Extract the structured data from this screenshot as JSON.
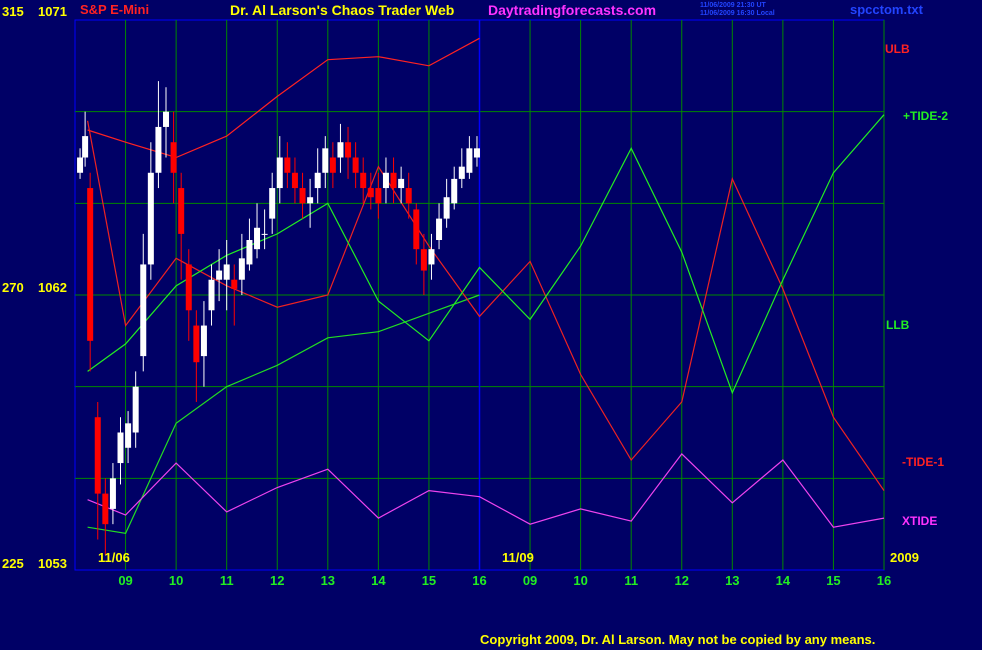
{
  "header": {
    "instrument": "S&P E-Mini",
    "title": "Dr. Al Larson's Chaos Trader Web",
    "site": "Daytradingforecasts.com",
    "timestamp_ut": "11/06/2009 21:30 UT",
    "timestamp_local": "11/06/2009 16:30 Local",
    "file": "spcctom.txt"
  },
  "footer": {
    "copyright": "Copyright 2009, Dr. Al Larson. May not be copied by any means."
  },
  "colors": {
    "background": "#000066",
    "grid": "#008800",
    "frame": "#0000ff",
    "price_up": "#ffffff",
    "price_down": "#ff0000",
    "ulb_line": "#ff2222",
    "llb_line": "#22dd22",
    "tide1_line": "#ee2222",
    "tide2_line": "#22ee22",
    "xtide_line": "#ee44ee",
    "label_yellow": "#ffff00",
    "label_green": "#22ee22",
    "label_red": "#ff2222",
    "label_magenta": "#ff33ff"
  },
  "chart_data": {
    "type": "line",
    "title": "S&P E-Mini",
    "y_axis_left": {
      "labels": [
        {
          "field": "315",
          "price": "1071"
        },
        {
          "field": "270",
          "price": "1062"
        },
        {
          "field": "225",
          "price": "1053"
        }
      ],
      "ylim": [
        1053,
        1071
      ]
    },
    "x_axis": {
      "day1_label": "11/06",
      "day2_label": "11/09",
      "year_label": "2009",
      "day1_hours": [
        "09",
        "10",
        "11",
        "12",
        "13",
        "14",
        "15",
        "16"
      ],
      "day2_hours": [
        "09",
        "10",
        "11",
        "12",
        "13",
        "14",
        "15",
        "16"
      ]
    },
    "series_labels": {
      "ulb": "ULB",
      "tide2": "+TIDE-2",
      "llb": "LLB",
      "tide1": "-TIDE-1",
      "xtide": "XTIDE"
    },
    "series": [
      {
        "name": "ULB",
        "x": [
          8.25,
          9,
          10,
          11,
          12,
          13,
          14,
          15,
          16
        ],
        "y": [
          1067.4,
          1067.0,
          1066.5,
          1067.2,
          1068.5,
          1069.7,
          1069.8,
          1069.5,
          1070.4
        ]
      },
      {
        "name": "LLB",
        "x": [
          8.25,
          9,
          10,
          11,
          12,
          13,
          14,
          15,
          16
        ],
        "y": [
          1054.4,
          1054.2,
          1057.8,
          1059.0,
          1059.7,
          1060.6,
          1060.8,
          1061.4,
          1062.0
        ]
      },
      {
        "name": "-TIDE-1",
        "x": [
          8.25,
          9,
          10,
          11,
          12,
          13,
          14,
          15,
          16,
          17,
          18,
          19,
          20,
          21,
          22,
          23,
          24
        ],
        "y": [
          1067.7,
          1061.0,
          1063.2,
          1062.3,
          1061.6,
          1062.0,
          1066.2,
          1063.6,
          1061.3,
          1063.1,
          1059.4,
          1056.6,
          1058.5,
          1065.8,
          1062.2,
          1058.0,
          1055.6
        ]
      },
      {
        "name": "+TIDE-2",
        "x": [
          8.25,
          9,
          10,
          11,
          12,
          13,
          14,
          15,
          16,
          17,
          18,
          19,
          20,
          21,
          22,
          23,
          24
        ],
        "y": [
          1059.5,
          1060.4,
          1062.3,
          1063.3,
          1064.0,
          1065.0,
          1061.8,
          1060.5,
          1062.9,
          1061.2,
          1063.6,
          1066.8,
          1063.4,
          1058.8,
          1062.5,
          1066.0,
          1067.9
        ]
      },
      {
        "name": "XTIDE",
        "x": [
          8.25,
          9,
          10,
          11,
          12,
          13,
          14,
          15,
          16,
          17,
          18,
          19,
          20,
          21,
          22,
          23,
          24
        ],
        "y": [
          1055.3,
          1054.8,
          1056.5,
          1054.9,
          1055.7,
          1056.3,
          1054.7,
          1055.6,
          1055.4,
          1054.5,
          1055.0,
          1054.6,
          1056.8,
          1055.2,
          1056.6,
          1054.4,
          1054.7
        ]
      }
    ],
    "price_bars": [
      {
        "x": 8.1,
        "o": 1066.0,
        "c": 1066.5,
        "h": 1066.8,
        "l": 1065.8
      },
      {
        "x": 8.2,
        "o": 1066.5,
        "c": 1067.2,
        "h": 1068.0,
        "l": 1066.2
      },
      {
        "x": 8.3,
        "o": 1065.5,
        "c": 1060.5,
        "h": 1066.0,
        "l": 1059.5
      },
      {
        "x": 8.45,
        "o": 1058.0,
        "c": 1055.5,
        "h": 1058.5,
        "l": 1054.0
      },
      {
        "x": 8.6,
        "o": 1055.5,
        "c": 1054.5,
        "h": 1056.0,
        "l": 1053.5
      },
      {
        "x": 8.75,
        "o": 1055.0,
        "c": 1056.0,
        "h": 1056.5,
        "l": 1054.5
      },
      {
        "x": 8.9,
        "o": 1056.5,
        "c": 1057.5,
        "h": 1058.0,
        "l": 1055.8
      },
      {
        "x": 9.05,
        "o": 1057.0,
        "c": 1057.8,
        "h": 1058.2,
        "l": 1056.5
      },
      {
        "x": 9.2,
        "o": 1057.5,
        "c": 1059.0,
        "h": 1059.5,
        "l": 1057.0
      },
      {
        "x": 9.35,
        "o": 1060.0,
        "c": 1063.0,
        "h": 1064.0,
        "l": 1059.5
      },
      {
        "x": 9.5,
        "o": 1063.0,
        "c": 1066.0,
        "h": 1067.0,
        "l": 1062.5
      },
      {
        "x": 9.65,
        "o": 1066.0,
        "c": 1067.5,
        "h": 1069.0,
        "l": 1065.5
      },
      {
        "x": 9.8,
        "o": 1067.5,
        "c": 1068.0,
        "h": 1068.8,
        "l": 1066.5
      },
      {
        "x": 9.95,
        "o": 1067.0,
        "c": 1066.0,
        "h": 1068.0,
        "l": 1065.0
      },
      {
        "x": 10.1,
        "o": 1065.5,
        "c": 1064.0,
        "h": 1066.0,
        "l": 1062.5
      },
      {
        "x": 10.25,
        "o": 1063.0,
        "c": 1061.5,
        "h": 1063.5,
        "l": 1060.5
      },
      {
        "x": 10.4,
        "o": 1061.0,
        "c": 1059.8,
        "h": 1061.5,
        "l": 1058.5
      },
      {
        "x": 10.55,
        "o": 1060.0,
        "c": 1061.0,
        "h": 1061.8,
        "l": 1059.0
      },
      {
        "x": 10.7,
        "o": 1061.5,
        "c": 1062.5,
        "h": 1063.0,
        "l": 1061.0
      },
      {
        "x": 10.85,
        "o": 1062.5,
        "c": 1062.8,
        "h": 1063.5,
        "l": 1061.8
      },
      {
        "x": 11.0,
        "o": 1062.5,
        "c": 1063.0,
        "h": 1063.8,
        "l": 1061.5
      },
      {
        "x": 11.15,
        "o": 1062.5,
        "c": 1062.2,
        "h": 1063.0,
        "l": 1061.0
      },
      {
        "x": 11.3,
        "o": 1062.5,
        "c": 1063.2,
        "h": 1064.0,
        "l": 1062.0
      },
      {
        "x": 11.45,
        "o": 1063.0,
        "c": 1063.8,
        "h": 1064.5,
        "l": 1062.8
      },
      {
        "x": 11.6,
        "o": 1063.5,
        "c": 1064.2,
        "h": 1065.0,
        "l": 1063.2
      },
      {
        "x": 11.75,
        "o": 1064.0,
        "c": 1064.0,
        "h": 1064.8,
        "l": 1063.5
      },
      {
        "x": 11.9,
        "o": 1064.5,
        "c": 1065.5,
        "h": 1066.0,
        "l": 1064.0
      },
      {
        "x": 12.05,
        "o": 1065.5,
        "c": 1066.5,
        "h": 1067.2,
        "l": 1065.0
      },
      {
        "x": 12.2,
        "o": 1066.5,
        "c": 1066.0,
        "h": 1067.0,
        "l": 1065.5
      },
      {
        "x": 12.35,
        "o": 1066.0,
        "c": 1065.5,
        "h": 1066.5,
        "l": 1065.0
      },
      {
        "x": 12.5,
        "o": 1065.5,
        "c": 1065.0,
        "h": 1066.0,
        "l": 1064.5
      },
      {
        "x": 12.65,
        "o": 1065.0,
        "c": 1065.2,
        "h": 1065.8,
        "l": 1064.2
      },
      {
        "x": 12.8,
        "o": 1065.5,
        "c": 1066.0,
        "h": 1066.8,
        "l": 1065.0
      },
      {
        "x": 12.95,
        "o": 1066.0,
        "c": 1066.8,
        "h": 1067.2,
        "l": 1065.5
      },
      {
        "x": 13.1,
        "o": 1066.5,
        "c": 1066.0,
        "h": 1067.0,
        "l": 1065.5
      },
      {
        "x": 13.25,
        "o": 1066.5,
        "c": 1067.0,
        "h": 1067.6,
        "l": 1066.0
      },
      {
        "x": 13.4,
        "o": 1067.0,
        "c": 1066.5,
        "h": 1067.5,
        "l": 1065.8
      },
      {
        "x": 13.55,
        "o": 1066.5,
        "c": 1066.0,
        "h": 1067.0,
        "l": 1065.5
      },
      {
        "x": 13.7,
        "o": 1066.0,
        "c": 1065.5,
        "h": 1066.5,
        "l": 1065.0
      },
      {
        "x": 13.85,
        "o": 1065.5,
        "c": 1065.2,
        "h": 1066.0,
        "l": 1064.8
      },
      {
        "x": 14.0,
        "o": 1065.5,
        "c": 1065.0,
        "h": 1066.0,
        "l": 1064.5
      },
      {
        "x": 14.15,
        "o": 1065.5,
        "c": 1066.0,
        "h": 1066.5,
        "l": 1065.0
      },
      {
        "x": 14.3,
        "o": 1066.0,
        "c": 1065.5,
        "h": 1066.5,
        "l": 1065.0
      },
      {
        "x": 14.45,
        "o": 1065.5,
        "c": 1065.8,
        "h": 1066.2,
        "l": 1065.0
      },
      {
        "x": 14.6,
        "o": 1065.5,
        "c": 1065.0,
        "h": 1066.0,
        "l": 1064.5
      },
      {
        "x": 14.75,
        "o": 1064.8,
        "c": 1063.5,
        "h": 1065.0,
        "l": 1063.0
      },
      {
        "x": 14.9,
        "o": 1063.5,
        "c": 1062.8,
        "h": 1064.0,
        "l": 1062.0
      },
      {
        "x": 15.05,
        "o": 1063.0,
        "c": 1063.5,
        "h": 1064.0,
        "l": 1062.5
      },
      {
        "x": 15.2,
        "o": 1063.8,
        "c": 1064.5,
        "h": 1065.0,
        "l": 1063.5
      },
      {
        "x": 15.35,
        "o": 1064.5,
        "c": 1065.2,
        "h": 1065.8,
        "l": 1064.2
      },
      {
        "x": 15.5,
        "o": 1065.0,
        "c": 1065.8,
        "h": 1066.2,
        "l": 1064.8
      },
      {
        "x": 15.65,
        "o": 1065.8,
        "c": 1066.2,
        "h": 1066.8,
        "l": 1065.5
      },
      {
        "x": 15.8,
        "o": 1066.0,
        "c": 1066.8,
        "h": 1067.2,
        "l": 1065.8
      },
      {
        "x": 15.95,
        "o": 1066.5,
        "c": 1066.8,
        "h": 1067.2,
        "l": 1066.2
      }
    ],
    "grid": true
  }
}
